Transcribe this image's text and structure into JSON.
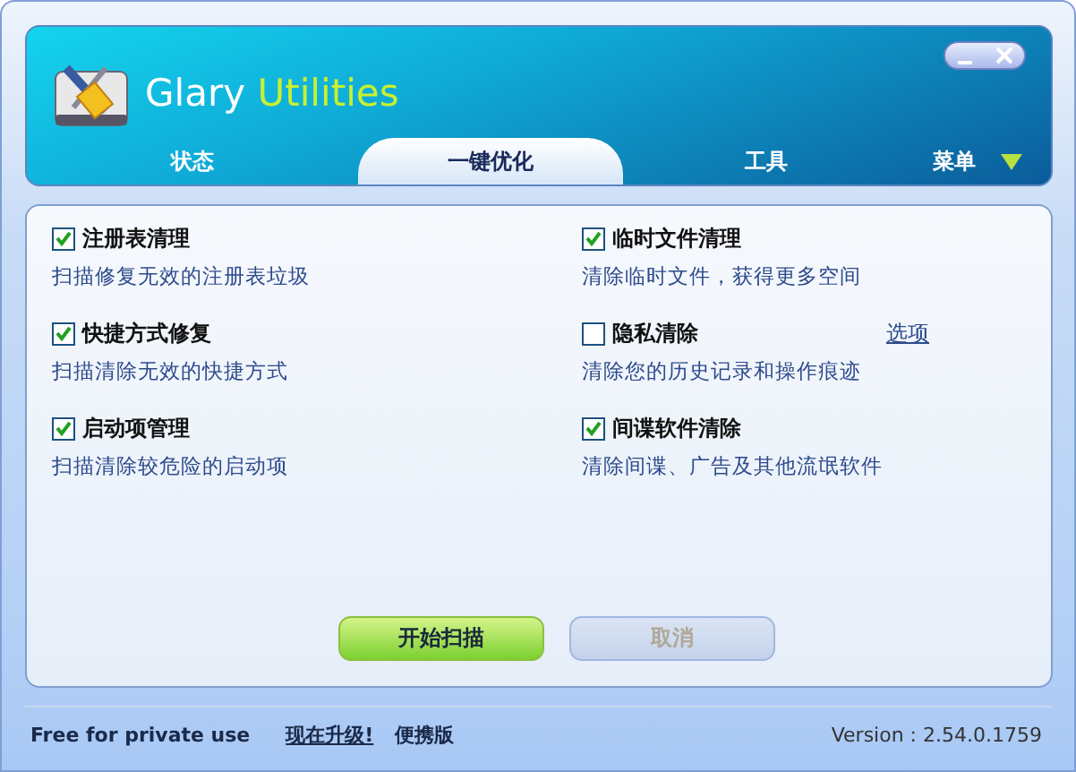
{
  "window": {
    "title_primary": "Glary",
    "title_secondary": "Utilities"
  },
  "tabs": [
    {
      "label": "状态",
      "selected": false
    },
    {
      "label": "一键优化",
      "selected": true
    },
    {
      "label": "工具",
      "selected": false
    }
  ],
  "menu": {
    "label": "菜单"
  },
  "tasks": [
    {
      "title": "注册表清理",
      "description": "扫描修复无效的注册表垃圾",
      "checked": true
    },
    {
      "title": "临时文件清理",
      "description": "清除临时文件，获得更多空间",
      "checked": true
    },
    {
      "title": "快捷方式修复",
      "description": "扫描清除无效的快捷方式",
      "checked": true
    },
    {
      "title": "隐私清除",
      "description": "清除您的历史记录和操作痕迹",
      "checked": false,
      "option_link": "选项"
    },
    {
      "title": "启动项管理",
      "description": "扫描清除较危险的启动项",
      "checked": true
    },
    {
      "title": "间谍软件清除",
      "description": "清除间谍、广告及其他流氓软件",
      "checked": true
    }
  ],
  "buttons": [
    {
      "label": "开始扫描",
      "disabled": false
    },
    {
      "label": "取消",
      "disabled": true
    }
  ],
  "status_bar": {
    "license": "Free for private use",
    "upgrade_link": "现在升级!",
    "portable": "便携版",
    "version": "Version : 2.54.0.1759"
  }
}
